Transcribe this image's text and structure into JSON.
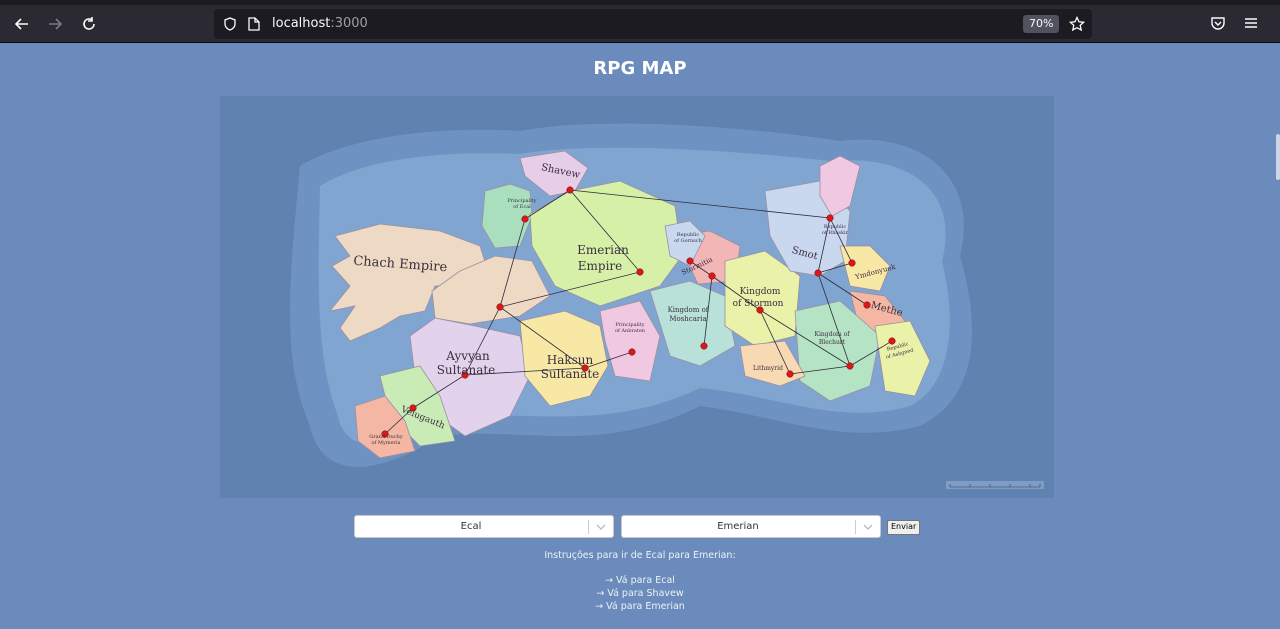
{
  "browser": {
    "url_host": "localhost",
    "url_port": ":3000",
    "zoom": "70%"
  },
  "page": {
    "title": "RPG MAP"
  },
  "map": {
    "regions": {
      "chach": "Chach Empire",
      "shavew": "Shavew",
      "ecal_1": "Principality",
      "ecal_2": "of Ecal",
      "emerian_1": "Emerian",
      "emerian_2": "Empire",
      "ayvyan_1": "Ayvyan",
      "ayvyan_2": "Sultanate",
      "haksun_1": "Haksun",
      "haksun_2": "Sultanate",
      "velugauth": "Velugauth",
      "gasbal_1": "Grand Duchy",
      "gasbal_2": "of Mymeria",
      "anbraten_1": "Principality",
      "anbraten_2": "of Anbraten",
      "mosucaria_1": "Kingdom of",
      "mosucaria_2": "Moshcaria",
      "stormitia": "Stormitia",
      "gornsch_1": "Republic",
      "gornsch_2": "of Gornsch",
      "stormon_1": "Kingdom",
      "stormon_2": "of Stormon",
      "smot": "Smot",
      "rhaskir_1": "Republic",
      "rhaskir_2": "of Rhaskir",
      "ymdonyuek": "Ymdonyuek",
      "methe": "Methe",
      "blechurt_1": "Kingdom of",
      "blechurt_2": "Blechurt",
      "lithmyrid": "Lithmyrid",
      "ashgned_1": "Republic",
      "ashgned_2": "of Ashgned"
    }
  },
  "form": {
    "from_value": "Ecal",
    "to_value": "Emerian",
    "submit_label": "Enviar"
  },
  "result": {
    "heading": "Instruções para ir de Ecal para Emerian:",
    "steps": [
      "→ Vá para Ecal",
      "→ Vá para Shavew",
      "→ Vá para Emerian"
    ]
  }
}
